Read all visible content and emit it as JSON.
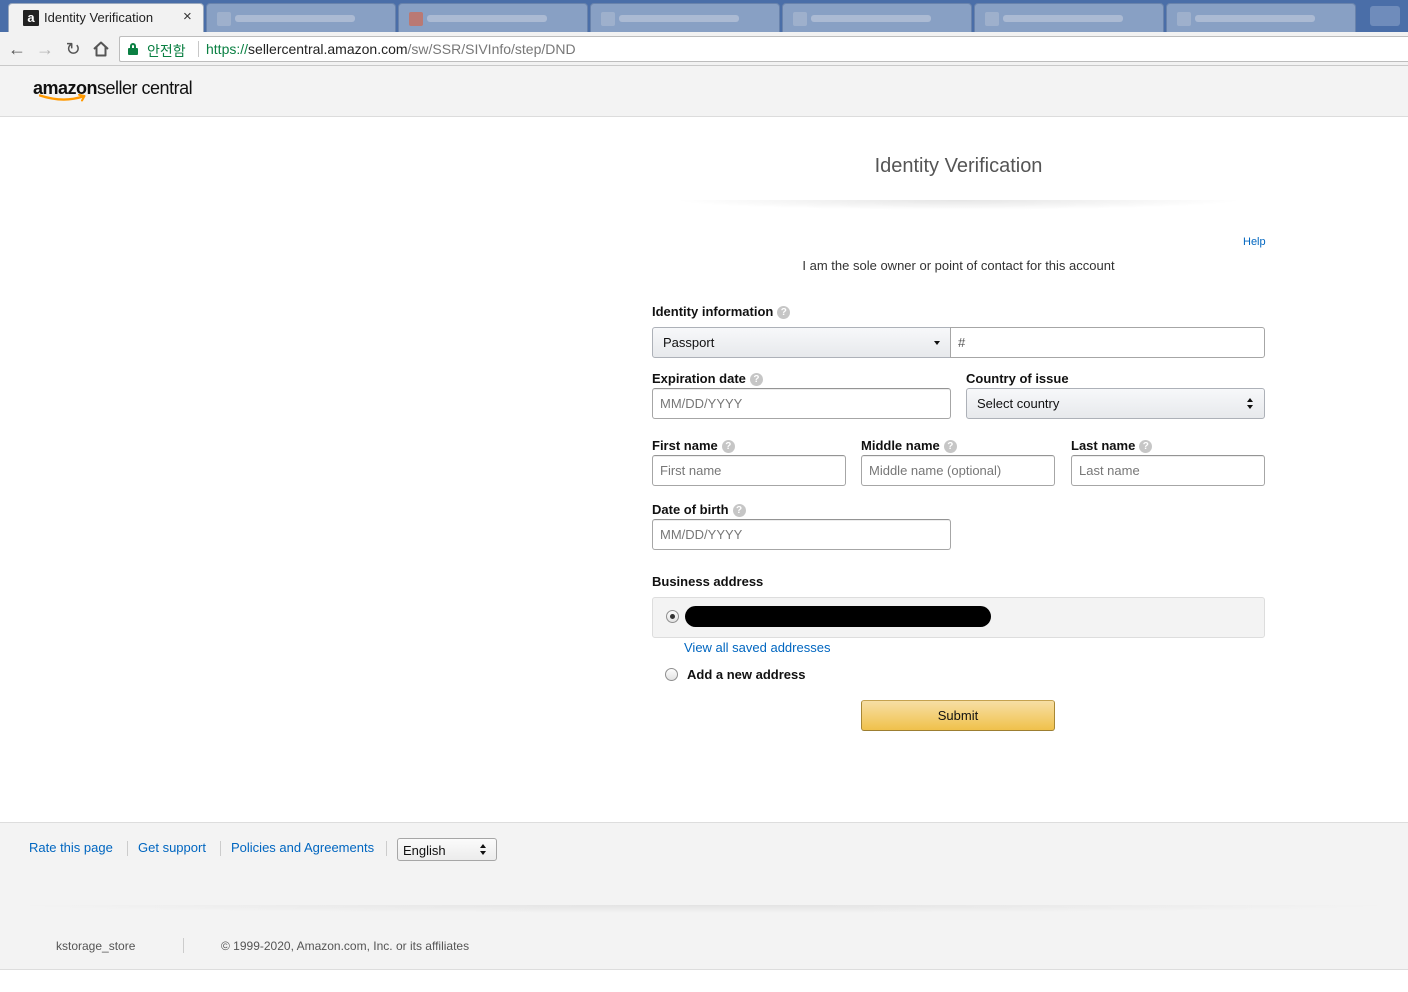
{
  "browser": {
    "active_tab_title": "Identity Verification",
    "active_tab_favicon": "a",
    "close_glyph": "×",
    "secure_label": "안전함",
    "url_scheme": "https://",
    "url_host": "sellercentral.amazon.com",
    "url_path": "/sw/SSR/SIVInfo/step/DND"
  },
  "header": {
    "brand": "amazon",
    "product": "seller central"
  },
  "form": {
    "title": "Identity Verification",
    "help_link": "Help",
    "subtitle": "I am the sole owner or point of contact for this account",
    "identity_label": "Identity information",
    "document_type": "Passport",
    "document_number_placeholder": "#",
    "expiration_label": "Expiration date",
    "expiration_placeholder": "MM/DD/YYYY",
    "country_label": "Country of issue",
    "country_value": "Select country",
    "first_name_label": "First name",
    "first_name_placeholder": "First name",
    "middle_name_label": "Middle name",
    "middle_name_placeholder": "Middle name (optional)",
    "last_name_label": "Last name",
    "last_name_placeholder": "Last name",
    "dob_label": "Date of birth",
    "dob_placeholder": "MM/DD/YYYY",
    "business_address_label": "Business address",
    "view_addresses_link": "View all saved addresses",
    "add_address_label": "Add a new address",
    "submit_label": "Submit",
    "help_glyph": "?"
  },
  "footer": {
    "links": [
      "Rate this page",
      "Get support",
      "Policies and Agreements"
    ],
    "language": "English",
    "store_name": "kstorage_store",
    "copyright": "© 1999-2020, Amazon.com, Inc. or its affiliates"
  },
  "colors": {
    "link": "#0066c0",
    "secure": "#0b8043",
    "submit_top": "#f7dfa5",
    "submit_bottom": "#f0c14b",
    "smile": "#f90"
  }
}
